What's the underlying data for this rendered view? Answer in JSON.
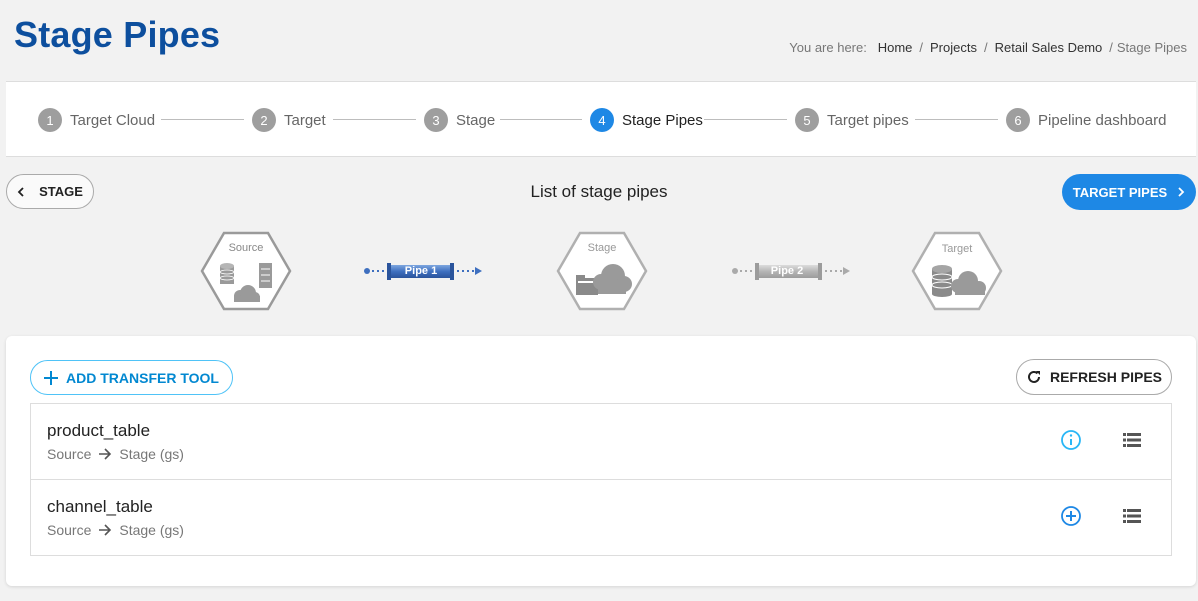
{
  "page": {
    "title": "Stage Pipes"
  },
  "breadcrumb": {
    "prefix": "You are here:",
    "links": [
      "Home",
      "Projects",
      "Retail Sales Demo"
    ],
    "current": "Stage Pipes"
  },
  "stepper": {
    "steps": [
      {
        "num": "1",
        "label": "Target Cloud",
        "active": false
      },
      {
        "num": "2",
        "label": "Target",
        "active": false
      },
      {
        "num": "3",
        "label": "Stage",
        "active": false
      },
      {
        "num": "4",
        "label": "Stage Pipes",
        "active": true
      },
      {
        "num": "5",
        "label": "Target pipes",
        "active": false
      },
      {
        "num": "6",
        "label": "Pipeline dashboard",
        "active": false
      }
    ]
  },
  "nav": {
    "back_label": "STAGE",
    "section_title": "List of stage pipes",
    "next_label": "TARGET PIPES"
  },
  "diagram": {
    "source_label": "Source",
    "pipe1_label": "Pipe 1",
    "stage_label": "Stage",
    "pipe2_label": "Pipe 2",
    "target_label": "Target"
  },
  "toolbar": {
    "add_label": "ADD TRANSFER TOOL",
    "refresh_label": "REFRESH PIPES"
  },
  "pipes": [
    {
      "name": "product_table",
      "from": "Source",
      "to": "Stage (gs)",
      "action_icon": "info-circle-icon"
    },
    {
      "name": "channel_table",
      "from": "Source",
      "to": "Stage (gs)",
      "action_icon": "add-circle-icon"
    }
  ],
  "colors": {
    "title": "#0d4f9e",
    "primary": "#1e88e5",
    "accent": "#0288d1",
    "info": "#29b6f6",
    "step_inactive": "#9e9e9e"
  }
}
